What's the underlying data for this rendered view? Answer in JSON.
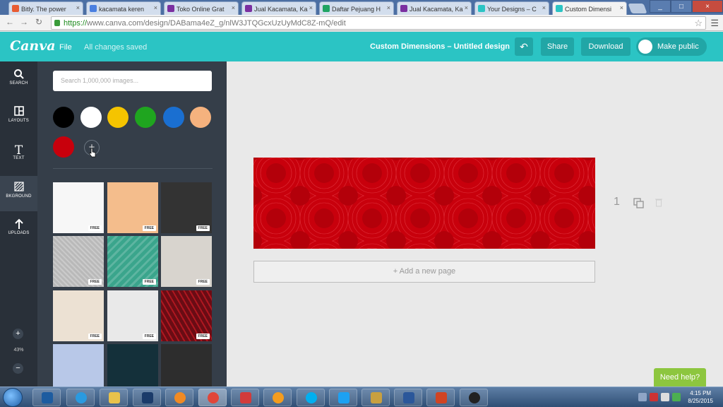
{
  "browser": {
    "tabs": [
      {
        "label": "Bitly. The power",
        "icon_name": "bitly-icon",
        "icon_color": "#e85c33",
        "active": false
      },
      {
        "label": "kacamata keren",
        "icon_name": "google-images-icon",
        "icon_color": "#4a7fe0",
        "active": false
      },
      {
        "label": "Toko Online Grat",
        "icon_name": "yahoo-icon",
        "icon_color": "#7b2fa0",
        "active": false
      },
      {
        "label": "Jual Kacamata, Ka",
        "icon_name": "yahoo-icon",
        "icon_color": "#7b2fa0",
        "active": false
      },
      {
        "label": "Daftar Pejuang H",
        "icon_name": "sheets-icon",
        "icon_color": "#1fa463",
        "active": false
      },
      {
        "label": "Jual Kacamata, Ka",
        "icon_name": "yahoo-icon",
        "icon_color": "#7b2fa0",
        "active": false
      },
      {
        "label": "Your Designs – C",
        "icon_name": "canva-icon",
        "icon_color": "#2bc4c4",
        "active": false
      },
      {
        "label": "Custom Dimensi",
        "icon_name": "canva-icon",
        "icon_color": "#2bc4c4",
        "active": true
      }
    ],
    "url_secure": "https://",
    "url_rest": "www.canva.com/design/DABama4eZ_g/nlW3JTQGcxUzUyMdC8Z-mQ/edit"
  },
  "header": {
    "logo": "Canva",
    "file_menu": "File",
    "save_status": "All changes saved",
    "design_title": "Custom Dimensions – Untitled design",
    "share_label": "Share",
    "download_label": "Download",
    "public_label": "Make public"
  },
  "rail": {
    "items": [
      {
        "label": "SEARCH",
        "icon_name": "search-icon"
      },
      {
        "label": "LAYOUTS",
        "icon_name": "layouts-icon"
      },
      {
        "label": "TEXT",
        "icon_name": "text-icon"
      },
      {
        "label": "BKGROUND",
        "icon_name": "background-icon"
      },
      {
        "label": "UPLOADS",
        "icon_name": "upload-icon"
      }
    ],
    "zoom": "43%"
  },
  "panel": {
    "search_placeholder": "Search 1,000,000 images...",
    "colors": [
      "#000000",
      "#ffffff",
      "#f5c400",
      "#1fa51f",
      "#1a6fd1",
      "#f5b27e",
      "#c8000c"
    ],
    "backgrounds": [
      {
        "badge": "FREE",
        "color": "#f7f7f7"
      },
      {
        "badge": "FREE",
        "color": "#f4bd8c"
      },
      {
        "badge": "FREE",
        "color": "#333333"
      },
      {
        "badge": "FREE",
        "color": "#b9b9b9"
      },
      {
        "badge": "FREE",
        "color": "#3aa58c"
      },
      {
        "badge": "FREE",
        "color": "#d8d4ce"
      },
      {
        "badge": "FREE",
        "color": "#ece1d3"
      },
      {
        "badge": "FREE",
        "color": "#e9e9e9"
      },
      {
        "badge": "FREE",
        "color": "#6a0c14"
      },
      {
        "badge": "",
        "color": "#b8c8e8"
      },
      {
        "badge": "",
        "color": "#14303a"
      },
      {
        "badge": "",
        "color": "#2d2d2d"
      }
    ]
  },
  "canvas": {
    "add_page": "+ Add a new page",
    "page_number": "1",
    "design_color": "#c8000c"
  },
  "help": "Need help?",
  "taskbar": {
    "apps": [
      {
        "name": "photoshop-icon",
        "color": "#1d5ca0"
      },
      {
        "name": "internet-explorer-icon",
        "color": "#2a9ae0"
      },
      {
        "name": "file-explorer-icon",
        "color": "#e8c24b"
      },
      {
        "name": "app-icon",
        "color": "#1b3b6a"
      },
      {
        "name": "media-player-icon",
        "color": "#f08a24"
      },
      {
        "name": "chrome-icon",
        "color": "#e0463a"
      },
      {
        "name": "refresh-app-icon",
        "color": "#d23b3b"
      },
      {
        "name": "orb-app-icon",
        "color": "#f39c1e"
      },
      {
        "name": "skype-icon",
        "color": "#00aff0"
      },
      {
        "name": "twitter-icon",
        "color": "#1da1f2"
      },
      {
        "name": "tools-icon",
        "color": "#c8a040"
      },
      {
        "name": "word-icon",
        "color": "#2b579a"
      },
      {
        "name": "powerpoint-icon",
        "color": "#d04423"
      },
      {
        "name": "obs-icon",
        "color": "#222222"
      }
    ],
    "time": "4:15 PM",
    "date": "8/25/2015"
  }
}
